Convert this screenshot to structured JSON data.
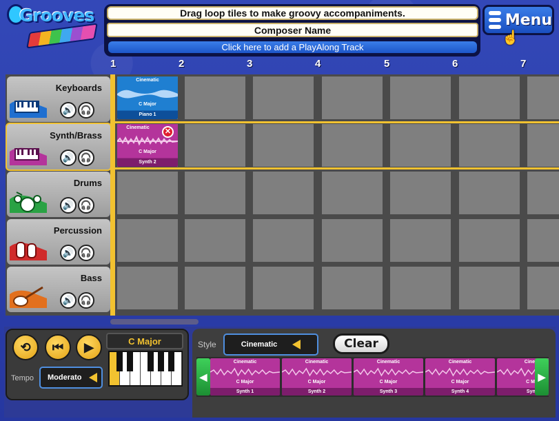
{
  "header": {
    "logo_text": "Grooves",
    "instruction": "Drag loop tiles to make groovy accompaniments.",
    "composer_name": "Composer Name",
    "playalong": "Click here to add a PlayAlong Track",
    "menu_label": "Menu"
  },
  "columns": [
    "1",
    "2",
    "3",
    "4",
    "5",
    "6",
    "7"
  ],
  "instruments": [
    {
      "name": "Keyboards",
      "icon": "keyboard-icon"
    },
    {
      "name": "Synth/Brass",
      "icon": "synth-icon"
    },
    {
      "name": "Drums",
      "icon": "drums-icon"
    },
    {
      "name": "Percussion",
      "icon": "congas-icon"
    },
    {
      "name": "Bass",
      "icon": "bass-guitar-icon"
    }
  ],
  "placed_tiles": [
    {
      "style": "Cinematic",
      "key": "C Major",
      "instrument": "Piano 1",
      "color": "#1f7fd1",
      "dark": "#0d4f9a"
    },
    {
      "style": "Cinematic",
      "key": "C Major",
      "instrument": "Synth 2",
      "color": "#b4349b",
      "dark": "#7d1d6c"
    }
  ],
  "transport": {
    "tempo_label": "Tempo",
    "tempo_value": "Moderato",
    "key": "C Major"
  },
  "style_panel": {
    "style_label": "Style",
    "style_value": "Cinematic",
    "clear_label": "Clear"
  },
  "loop_tiles": [
    {
      "style": "Cinematic",
      "key": "C Major",
      "instrument": "Synth 1"
    },
    {
      "style": "Cinematic",
      "key": "C Major",
      "instrument": "Synth 2"
    },
    {
      "style": "Cinematic",
      "key": "C Major",
      "instrument": "Synth 3"
    },
    {
      "style": "Cinematic",
      "key": "C Major",
      "instrument": "Synth 4"
    },
    {
      "style": "Cinem",
      "key": "C Ma",
      "instrument": "Synt"
    }
  ],
  "colors": {
    "accent_yellow": "#f2c230",
    "tile_blue": "#1f7fd1",
    "tile_magenta": "#b4349b",
    "button_blue": "#2a66d8"
  }
}
